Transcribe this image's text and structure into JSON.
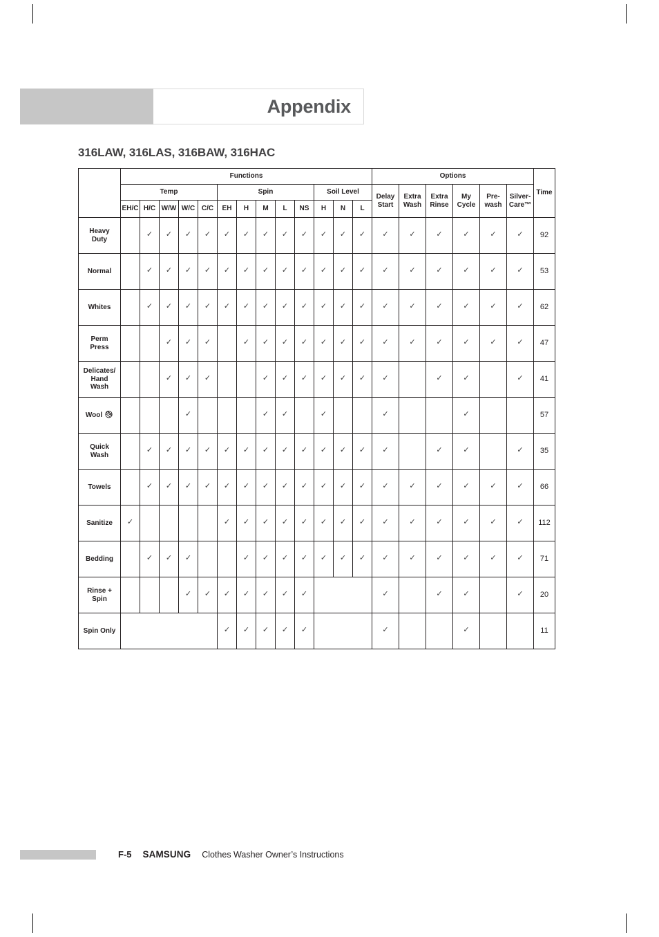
{
  "header": {
    "title": "Appendix"
  },
  "section": {
    "title": "316LAW, 316LAS, 316BAW, 316HAC"
  },
  "table": {
    "group_headers": {
      "functions": "Functions",
      "options": "Options",
      "time": "Time"
    },
    "sub_headers": {
      "temp": "Temp",
      "spin": "Spin",
      "soil_level": "Soil Level"
    },
    "temp_columns": [
      "EH/C",
      "H/C",
      "W/W",
      "W/C",
      "C/C"
    ],
    "spin_columns": [
      "EH",
      "H",
      "M",
      "L",
      "NS"
    ],
    "soil_columns": [
      "H",
      "N",
      "L"
    ],
    "option_columns": [
      "Delay\nStart",
      "Extra\nWash",
      "Extra\nRinse",
      "My\nCycle",
      "Pre-\nwash",
      "Silver-\nCare™"
    ],
    "check_glyph": "✓",
    "rows": [
      {
        "cycle": "Heavy\nDuty",
        "icon": "",
        "temp": [
          false,
          true,
          true,
          true,
          true
        ],
        "spin": [
          true,
          true,
          true,
          true,
          true
        ],
        "soil": [
          true,
          true,
          true
        ],
        "options": [
          true,
          true,
          true,
          true,
          true,
          true
        ],
        "time": "92",
        "merge_temp": false,
        "merge_soil": false
      },
      {
        "cycle": "Normal",
        "icon": "",
        "temp": [
          false,
          true,
          true,
          true,
          true
        ],
        "spin": [
          true,
          true,
          true,
          true,
          true
        ],
        "soil": [
          true,
          true,
          true
        ],
        "options": [
          true,
          true,
          true,
          true,
          true,
          true
        ],
        "time": "53",
        "merge_temp": false,
        "merge_soil": false
      },
      {
        "cycle": "Whites",
        "icon": "",
        "temp": [
          false,
          true,
          true,
          true,
          true
        ],
        "spin": [
          true,
          true,
          true,
          true,
          true
        ],
        "soil": [
          true,
          true,
          true
        ],
        "options": [
          true,
          true,
          true,
          true,
          true,
          true
        ],
        "time": "62",
        "merge_temp": false,
        "merge_soil": false
      },
      {
        "cycle": "Perm\nPress",
        "icon": "",
        "temp": [
          false,
          false,
          true,
          true,
          true
        ],
        "spin": [
          false,
          true,
          true,
          true,
          true
        ],
        "soil": [
          true,
          true,
          true
        ],
        "options": [
          true,
          true,
          true,
          true,
          true,
          true
        ],
        "time": "47",
        "merge_temp": false,
        "merge_soil": false
      },
      {
        "cycle": "Delicates/\nHand\nWash",
        "icon": "",
        "temp": [
          false,
          false,
          true,
          true,
          true
        ],
        "spin": [
          false,
          false,
          true,
          true,
          true
        ],
        "soil": [
          true,
          true,
          true
        ],
        "options": [
          true,
          false,
          true,
          true,
          false,
          true
        ],
        "time": "41",
        "merge_temp": false,
        "merge_soil": false
      },
      {
        "cycle": "Wool",
        "icon": "wool-icon",
        "temp": [
          false,
          false,
          false,
          true,
          false
        ],
        "spin": [
          false,
          false,
          true,
          true,
          false
        ],
        "soil": [
          true,
          false,
          false
        ],
        "options": [
          true,
          false,
          false,
          true,
          false,
          false
        ],
        "time": "57",
        "merge_temp": false,
        "merge_soil": false
      },
      {
        "cycle": "Quick\nWash",
        "icon": "",
        "temp": [
          false,
          true,
          true,
          true,
          true
        ],
        "spin": [
          true,
          true,
          true,
          true,
          true
        ],
        "soil": [
          true,
          true,
          true
        ],
        "options": [
          true,
          false,
          true,
          true,
          false,
          true
        ],
        "time": "35",
        "merge_temp": false,
        "merge_soil": false
      },
      {
        "cycle": "Towels",
        "icon": "",
        "temp": [
          false,
          true,
          true,
          true,
          true
        ],
        "spin": [
          true,
          true,
          true,
          true,
          true
        ],
        "soil": [
          true,
          true,
          true
        ],
        "options": [
          true,
          true,
          true,
          true,
          true,
          true
        ],
        "time": "66",
        "merge_temp": false,
        "merge_soil": false
      },
      {
        "cycle": "Sanitize",
        "icon": "",
        "temp": [
          true,
          false,
          false,
          false,
          false
        ],
        "spin": [
          true,
          true,
          true,
          true,
          true
        ],
        "soil": [
          true,
          true,
          true
        ],
        "options": [
          true,
          true,
          true,
          true,
          true,
          true
        ],
        "time": "112",
        "merge_temp": false,
        "merge_soil": false
      },
      {
        "cycle": "Bedding",
        "icon": "",
        "temp": [
          false,
          true,
          true,
          true,
          false
        ],
        "spin": [
          false,
          true,
          true,
          true,
          true
        ],
        "soil": [
          true,
          true,
          true
        ],
        "options": [
          true,
          true,
          true,
          true,
          true,
          true
        ],
        "time": "71",
        "merge_temp": false,
        "merge_soil": false
      },
      {
        "cycle": "Rinse +\nSpin",
        "icon": "",
        "temp": [
          false,
          false,
          false,
          true,
          true
        ],
        "spin": [
          true,
          true,
          true,
          true,
          true
        ],
        "soil": [
          false,
          false,
          false
        ],
        "options": [
          true,
          false,
          true,
          true,
          false,
          true
        ],
        "time": "20",
        "merge_temp": false,
        "merge_soil": true
      },
      {
        "cycle": "Spin Only",
        "icon": "",
        "temp": [
          false,
          false,
          false,
          false,
          false
        ],
        "spin": [
          true,
          true,
          true,
          true,
          true
        ],
        "soil": [
          false,
          false,
          false
        ],
        "options": [
          true,
          false,
          false,
          true,
          false,
          false
        ],
        "time": "11",
        "merge_temp": true,
        "merge_soil": true
      }
    ]
  },
  "footer": {
    "page": "F-5",
    "brand": "SAMSUNG",
    "text": "Clothes Washer Owner’s Instructions"
  }
}
